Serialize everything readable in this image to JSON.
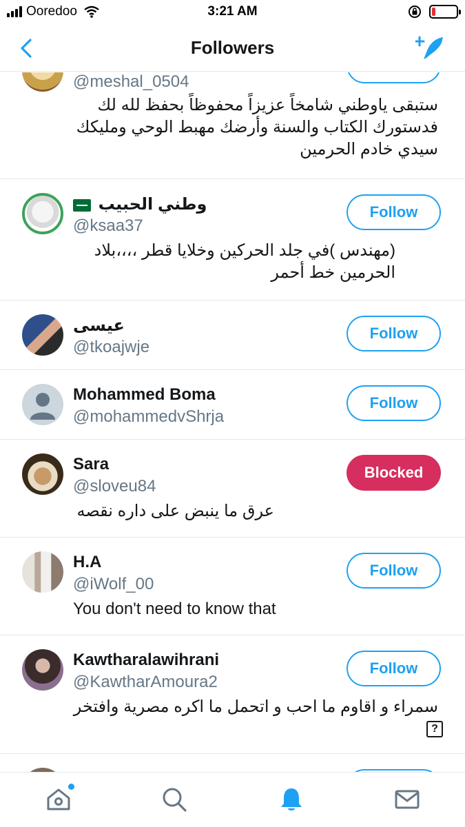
{
  "status_bar": {
    "carrier": "Ooredoo",
    "time": "3:21 AM",
    "battery_level": 0.15
  },
  "nav": {
    "title": "Followers",
    "back_icon": "chevron-left-icon",
    "compose_icon": "add-feather-icon"
  },
  "followers": [
    {
      "name": "",
      "handle": "@meshal_0504",
      "bio": "ستبقى ياوطني شامخاً عزيزاً محفوظاً بحفظ لله لك فدستورك الكتاب والسنة وأرضك مهبط الوحي ومليكك سيدي خادم الحرمين",
      "button": ""
    },
    {
      "name": "وطني الحبيب",
      "handle": "@ksaa37",
      "bio": "(مهندس )في جلد الحركين وخلايا قطر ،،،،بلاد الحرمين خط أحمر",
      "button": "Follow"
    },
    {
      "name": "عيسى",
      "handle": "@tkoajwje",
      "bio": "",
      "button": "Follow"
    },
    {
      "name": "Mohammed Boma",
      "handle": "@mohammedvShrja",
      "bio": "",
      "button": "Follow"
    },
    {
      "name": "Sara",
      "handle": "@sloveu84",
      "bio": "عرق ما ينبض على داره نقصه",
      "button": "Blocked"
    },
    {
      "name": "H.A",
      "handle": "@iWolf_00",
      "bio": "You don't need to know that",
      "button": "Follow"
    },
    {
      "name": "Kawtharalawihrani",
      "handle": "@KawtharAmoura2",
      "bio": "سمراء و اقاوم ما احب و اتحمل ما اكره مصرية وافتخر",
      "button": "Follow"
    }
  ],
  "unknown_glyph": "?",
  "tabs": [
    {
      "icon": "home-icon",
      "active": false,
      "badge": true
    },
    {
      "icon": "search-icon",
      "active": false,
      "badge": false
    },
    {
      "icon": "bell-icon",
      "active": true,
      "badge": false
    },
    {
      "icon": "mail-icon",
      "active": false,
      "badge": false
    }
  ],
  "colors": {
    "accent": "#1da1f2",
    "blocked": "#d62e5e",
    "secondary_text": "#657786",
    "divider": "#e1e8ed"
  }
}
